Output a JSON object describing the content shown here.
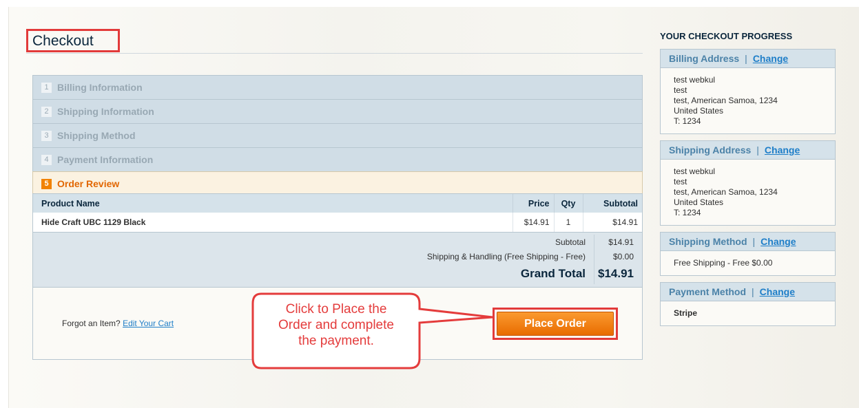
{
  "page": {
    "title": "Checkout"
  },
  "steps": [
    {
      "num": "1",
      "label": "Billing Information"
    },
    {
      "num": "2",
      "label": "Shipping Information"
    },
    {
      "num": "3",
      "label": "Shipping Method"
    },
    {
      "num": "4",
      "label": "Payment Information"
    },
    {
      "num": "5",
      "label": "Order Review"
    }
  ],
  "review": {
    "headers": {
      "name": "Product Name",
      "price": "Price",
      "qty": "Qty",
      "subtotal": "Subtotal"
    },
    "items": [
      {
        "name": "Hide Craft UBC 1129 Black",
        "price": "$14.91",
        "qty": "1",
        "subtotal": "$14.91"
      }
    ],
    "totals": {
      "subtotal_label": "Subtotal",
      "subtotal_value": "$14.91",
      "shipping_label": "Shipping & Handling (Free Shipping - Free)",
      "shipping_value": "$0.00",
      "grand_label": "Grand Total",
      "grand_value": "$14.91"
    },
    "forgot_text": "Forgot an Item?",
    "edit_cart_link": "Edit Your Cart",
    "place_order_label": "Place Order"
  },
  "callout": {
    "lines": [
      "Click to Place the",
      "Order and complete",
      "the payment."
    ],
    "color": "#e43c3c"
  },
  "sidebar": {
    "title": "YOUR CHECKOUT PROGRESS",
    "billing": {
      "heading": "Billing Address",
      "sep": "|",
      "change": "Change",
      "lines": [
        "test webkul",
        "test",
        "test, American Samoa, 1234",
        "United States",
        "T: 1234"
      ]
    },
    "shipping": {
      "heading": "Shipping Address",
      "sep": "|",
      "change": "Change",
      "lines": [
        "test webkul",
        "test",
        "test, American Samoa, 1234",
        "United States",
        "T: 1234"
      ]
    },
    "shipping_method": {
      "heading": "Shipping Method",
      "sep": "|",
      "change": "Change",
      "value": "Free Shipping - Free $0.00"
    },
    "payment_method": {
      "heading": "Payment Method",
      "sep": "|",
      "change": "Change",
      "value": "Stripe"
    }
  },
  "colors": {
    "accent_orange": "#f18200",
    "highlight_red": "#e23a3a",
    "link_blue": "#1e7ec8"
  }
}
